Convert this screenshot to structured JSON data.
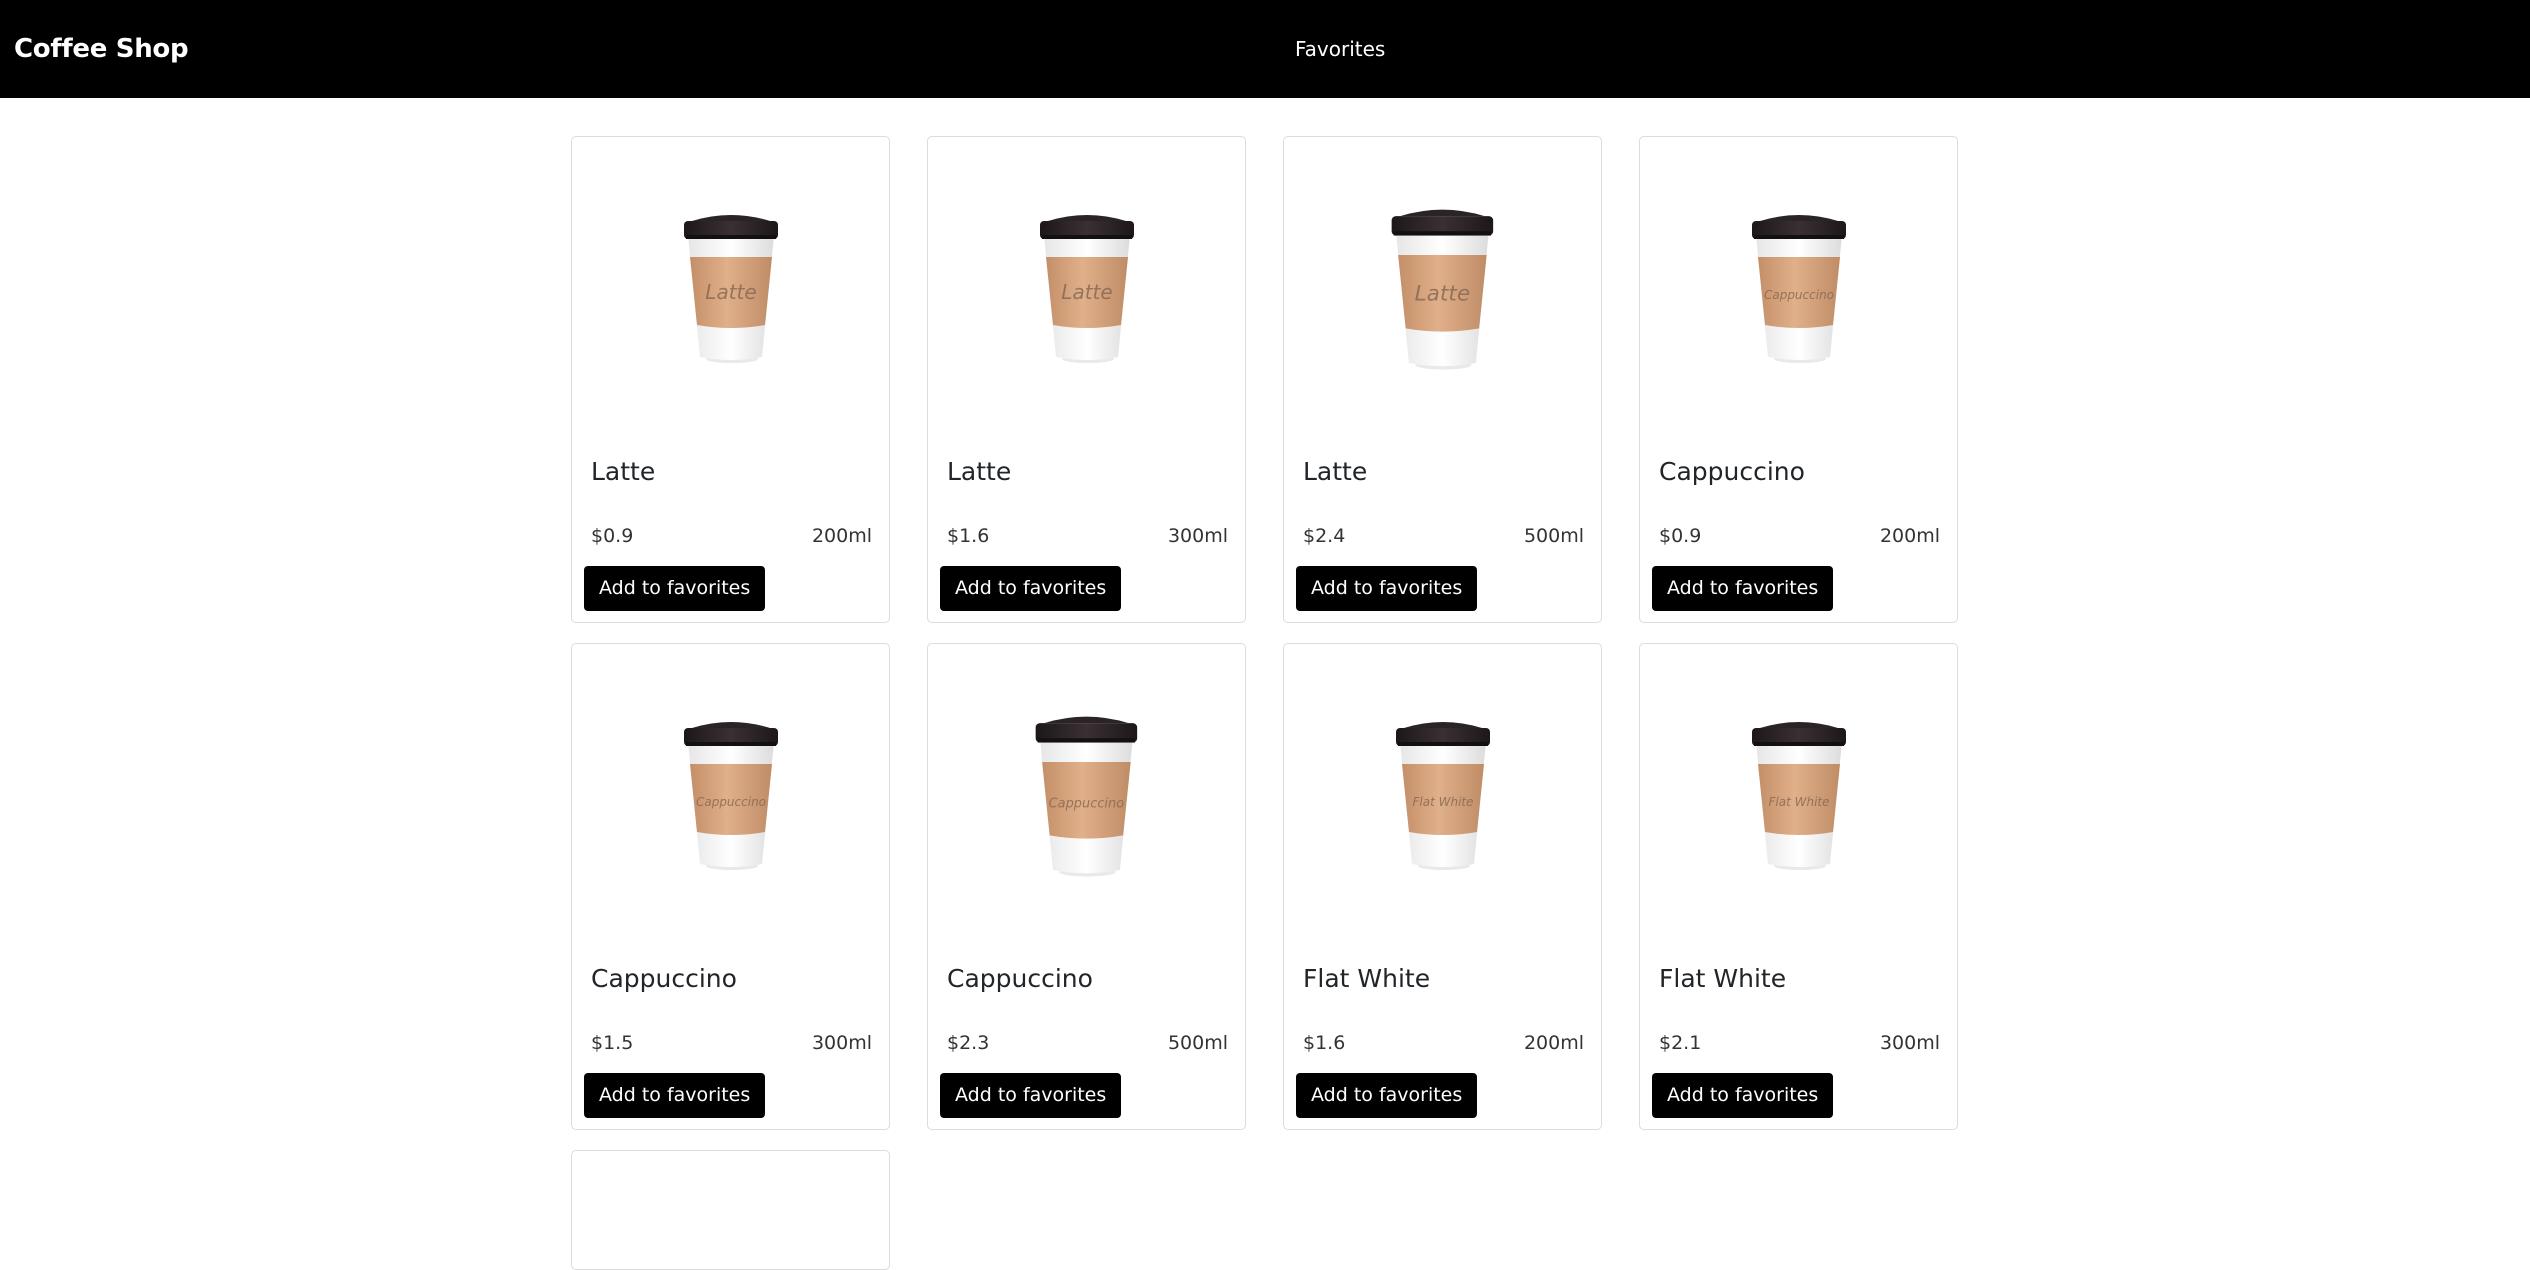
{
  "navbar": {
    "brand": "Coffee Shop",
    "favorites_link": "Favorites"
  },
  "colors": {
    "navbar_bg": "#000000",
    "button_bg": "#000000",
    "button_text": "#ffffff",
    "cup_sleeve": "#d4a27c",
    "cup_lid": "#2b2426"
  },
  "products": [
    {
      "name": "Latte",
      "price": "$0.9",
      "size": "200ml",
      "cup_label": "Latte",
      "button": "Add to favorites"
    },
    {
      "name": "Latte",
      "price": "$1.6",
      "size": "300ml",
      "cup_label": "Latte",
      "button": "Add to favorites"
    },
    {
      "name": "Latte",
      "price": "$2.4",
      "size": "500ml",
      "cup_label": "Latte",
      "button": "Add to favorites"
    },
    {
      "name": "Cappuccino",
      "price": "$0.9",
      "size": "200ml",
      "cup_label": "Cappuccino",
      "button": "Add to favorites"
    },
    {
      "name": "Cappuccino",
      "price": "$1.5",
      "size": "300ml",
      "cup_label": "Cappuccino",
      "button": "Add to favorites"
    },
    {
      "name": "Cappuccino",
      "price": "$2.3",
      "size": "500ml",
      "cup_label": "Cappuccino",
      "button": "Add to favorites"
    },
    {
      "name": "Flat White",
      "price": "$1.6",
      "size": "200ml",
      "cup_label": "Flat White",
      "button": "Add to favorites"
    },
    {
      "name": "Flat White",
      "price": "$2.1",
      "size": "300ml",
      "cup_label": "Flat White",
      "button": "Add to favorites"
    }
  ]
}
